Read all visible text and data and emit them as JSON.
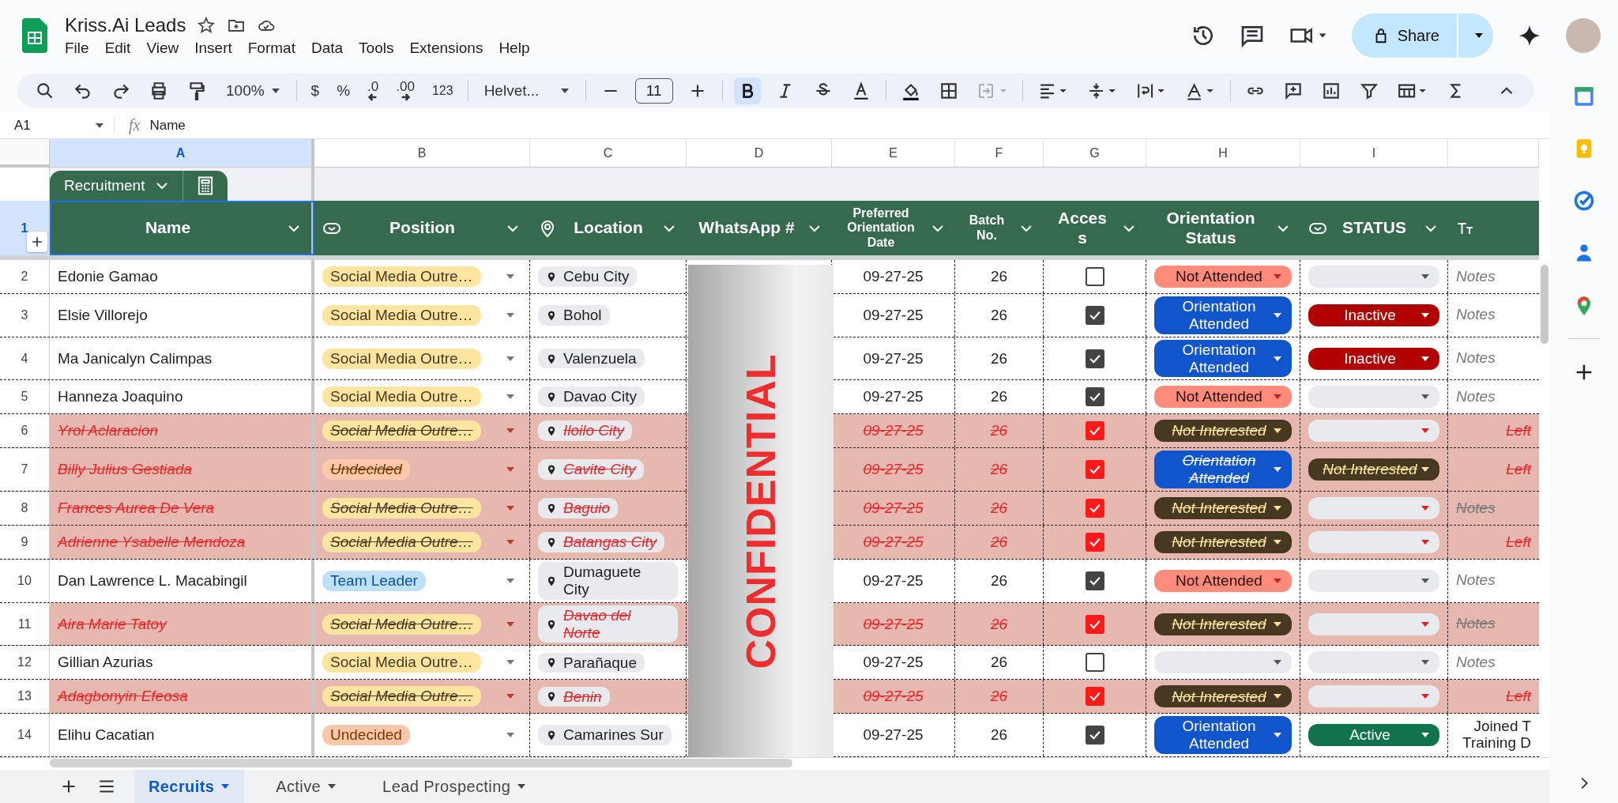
{
  "document": {
    "title": "Kriss.Ai Leads"
  },
  "menu": [
    "File",
    "Edit",
    "View",
    "Insert",
    "Format",
    "Data",
    "Tools",
    "Extensions",
    "Help"
  ],
  "share": {
    "label": "Share"
  },
  "toolbar": {
    "zoom": "100%",
    "currency": "$",
    "percent": "%",
    "decimal_decrease": ".0",
    "decimal_increase": ".00",
    "number_format": "123",
    "font": "Helvet...",
    "font_size": "11",
    "bold_selected": true,
    "merge_disabled": true
  },
  "formula_bar": {
    "cell": "A1",
    "fx": "fx",
    "value": "Name"
  },
  "columns": [
    {
      "letter": "A",
      "selected": true
    },
    {
      "letter": "B",
      "selected": false
    },
    {
      "letter": "C",
      "selected": false
    },
    {
      "letter": "D",
      "selected": false
    },
    {
      "letter": "E",
      "selected": false
    },
    {
      "letter": "F",
      "selected": false
    },
    {
      "letter": "G",
      "selected": false
    },
    {
      "letter": "H",
      "selected": false
    },
    {
      "letter": "I",
      "selected": false
    }
  ],
  "table_group": {
    "label": "Recruitment"
  },
  "header": {
    "row_number": "1",
    "cells": [
      {
        "label": "Name"
      },
      {
        "label": "Position"
      },
      {
        "label": "Location"
      },
      {
        "label": "WhatsApp #"
      },
      {
        "label": "Preferred Orientation Date"
      },
      {
        "label": "Batch No."
      },
      {
        "label": "Access"
      },
      {
        "label": "Orientation Status"
      },
      {
        "label": "STATUS"
      },
      {}
    ]
  },
  "overlay": {
    "text": "CONFIDENTIAL"
  },
  "rows": [
    {
      "number": "2",
      "name": "Edonie Gamao",
      "struck": false,
      "position": {
        "text": "Social Media Outre…",
        "kind": "yellow"
      },
      "location": "Cebu City",
      "date": "09-27-25",
      "batch": "26",
      "access": false,
      "orientation": {
        "text": "Not Attended",
        "kind": "salmon"
      },
      "status": {
        "kind": "empty"
      },
      "notes": {
        "text": "Notes",
        "kind": "placeholder"
      }
    },
    {
      "number": "3",
      "name": "Elsie Villorejo",
      "struck": false,
      "position": {
        "text": "Social Media Outre…",
        "kind": "yellow"
      },
      "location": "Bohol",
      "date": "09-27-25",
      "batch": "26",
      "access": true,
      "orientation": {
        "text": "Orientation Attended",
        "kind": "blue"
      },
      "status": {
        "text": "Inactive",
        "kind": "red"
      },
      "notes": {
        "text": "Notes",
        "kind": "placeholder"
      }
    },
    {
      "number": "4",
      "name": "Ma Janicalyn Calimpas",
      "struck": false,
      "position": {
        "text": "Social Media Outre…",
        "kind": "yellow"
      },
      "location": "Valenzuela",
      "date": "09-27-25",
      "batch": "26",
      "access": true,
      "orientation": {
        "text": "Orientation Attended",
        "kind": "blue"
      },
      "status": {
        "text": "Inactive",
        "kind": "red"
      },
      "notes": {
        "text": "Notes",
        "kind": "placeholder"
      }
    },
    {
      "number": "5",
      "name": "Hanneza Joaquino",
      "struck": false,
      "position": {
        "text": "Social Media Outre…",
        "kind": "yellow"
      },
      "location": "Davao City",
      "date": "09-27-25",
      "batch": "26",
      "access": true,
      "orientation": {
        "text": "Not Attended",
        "kind": "salmon"
      },
      "status": {
        "kind": "empty"
      },
      "notes": {
        "text": "Notes",
        "kind": "placeholder"
      }
    },
    {
      "number": "6",
      "name": "Yrol Aclaracion",
      "struck": true,
      "position": {
        "text": "Social Media Outre…",
        "kind": "yellow"
      },
      "location": "Iloilo City",
      "date": "09-27-25",
      "batch": "26",
      "access": true,
      "orientation": {
        "text": "Not Interested",
        "kind": "brown"
      },
      "status": {
        "kind": "empty"
      },
      "notes": {
        "text": "Left",
        "kind": "value"
      }
    },
    {
      "number": "7",
      "name": "Billy Julius Gestiada",
      "struck": true,
      "position": {
        "text": "Undecided",
        "kind": "orange"
      },
      "location": "Cavite City",
      "date": "09-27-25",
      "batch": "26",
      "access": true,
      "orientation": {
        "text": "Orientation Attended",
        "kind": "blue"
      },
      "status": {
        "text": "Not Interested",
        "kind": "brown"
      },
      "notes": {
        "text": "Left",
        "kind": "value"
      }
    },
    {
      "number": "8",
      "name": "Frances Aurea De Vera",
      "struck": true,
      "position": {
        "text": "Social Media Outre…",
        "kind": "yellow"
      },
      "location": "Baguio",
      "date": "09-27-25",
      "batch": "26",
      "access": true,
      "orientation": {
        "text": "Not Interested",
        "kind": "brown"
      },
      "status": {
        "kind": "empty"
      },
      "notes": {
        "text": "Notes",
        "kind": "placeholder"
      }
    },
    {
      "number": "9",
      "name": "Adrienne Ysabelle Mendoza",
      "struck": true,
      "position": {
        "text": "Social Media Outre…",
        "kind": "yellow"
      },
      "location": "Batangas City",
      "date": "09-27-25",
      "batch": "26",
      "access": true,
      "orientation": {
        "text": "Not Interested",
        "kind": "brown"
      },
      "status": {
        "kind": "empty"
      },
      "notes": {
        "text": "Left",
        "kind": "value"
      }
    },
    {
      "number": "10",
      "name": "Dan Lawrence L. Macabingil",
      "struck": false,
      "position": {
        "text": "Team Leader",
        "kind": "blue"
      },
      "location": "Dumaguete City",
      "date": "09-27-25",
      "batch": "26",
      "access": true,
      "orientation": {
        "text": "Not Attended",
        "kind": "salmon"
      },
      "status": {
        "kind": "empty"
      },
      "notes": {
        "text": "Notes",
        "kind": "placeholder"
      }
    },
    {
      "number": "11",
      "name": "Aira Marie Tatoy",
      "struck": true,
      "position": {
        "text": "Social Media Outre…",
        "kind": "yellow"
      },
      "location": "Davao del Norte",
      "date": "09-27-25",
      "batch": "26",
      "access": true,
      "orientation": {
        "text": "Not Interested",
        "kind": "brown"
      },
      "status": {
        "kind": "empty"
      },
      "notes": {
        "text": "Notes",
        "kind": "placeholder"
      }
    },
    {
      "number": "12",
      "name": "Gillian Azurias",
      "struck": false,
      "position": {
        "text": "Social Media Outre…",
        "kind": "yellow"
      },
      "location": "Parañaque",
      "date": "09-27-25",
      "batch": "26",
      "access": false,
      "orientation": {
        "kind": "empty"
      },
      "status": {
        "kind": "empty"
      },
      "notes": {
        "text": "Notes",
        "kind": "placeholder"
      }
    },
    {
      "number": "13",
      "name": "Adagbonyin Efeosa",
      "struck": true,
      "position": {
        "text": "Social Media Outre…",
        "kind": "yellow"
      },
      "location": "Benin",
      "date": "09-27-25",
      "batch": "26",
      "access": true,
      "orientation": {
        "text": "Not Interested",
        "kind": "brown"
      },
      "status": {
        "kind": "empty"
      },
      "notes": {
        "text": "Left",
        "kind": "value"
      }
    },
    {
      "number": "14",
      "name": "Elihu Cacatian",
      "struck": false,
      "position": {
        "text": "Undecided",
        "kind": "orange"
      },
      "location": "Camarines Sur",
      "date": "09-27-25",
      "batch": "26",
      "access": true,
      "orientation": {
        "text": "Orientation Attended",
        "kind": "blue"
      },
      "status": {
        "text": "Active",
        "kind": "green"
      },
      "notes": {
        "text": "Joined T\nTraining D",
        "kind": "value"
      }
    }
  ],
  "sheet_tabs": [
    {
      "label": "Recruits",
      "selected": true
    },
    {
      "label": "Active",
      "selected": false
    },
    {
      "label": "Lead Prospecting",
      "selected": false
    }
  ]
}
